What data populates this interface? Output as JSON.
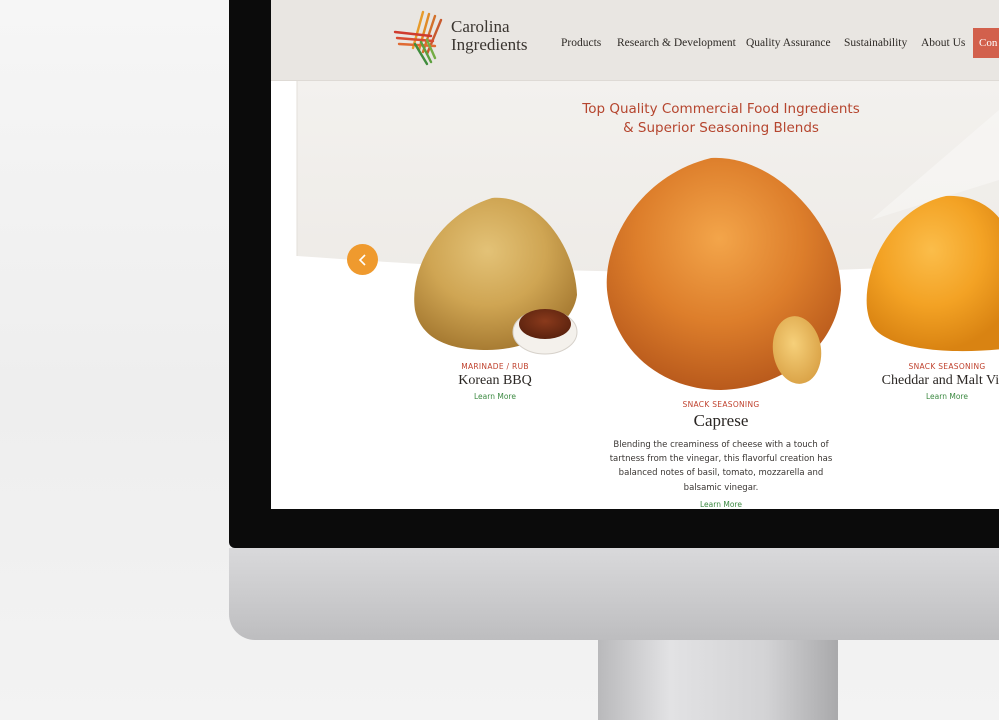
{
  "brand": {
    "line1": "Carolina",
    "line2": "Ingredients"
  },
  "nav": {
    "items": [
      "Products",
      "Research & Development",
      "Quality Assurance",
      "Sustainability",
      "About Us"
    ],
    "contact_label": "Con"
  },
  "hero": {
    "title_line1": "Top Quality Commercial Food Ingredients",
    "title_line2": "& Superior Seasoning Blends"
  },
  "icons": {
    "prev": "chevron-left-icon",
    "logo": "carolina-ingredients-logo"
  },
  "products": [
    {
      "category": "MARINADE / RUB",
      "name": "Korean BBQ",
      "link": "Learn More"
    },
    {
      "category": "SNACK SEASONING",
      "name": "Caprese",
      "description_lines": [
        "Blending the creaminess of cheese with a touch of",
        "tartness from the vinegar, this flavorful creation has",
        "balanced notes of basil, tomato, mozzarella and",
        "balsamic vinegar."
      ],
      "link": "Learn More"
    },
    {
      "category": "SNACK SEASONING",
      "name": "Cheddar and Malt Vine",
      "link": "Learn More"
    }
  ],
  "colors": {
    "accent_red": "#b5452e",
    "accent_orange": "#ef9a2e",
    "link_green": "#3c8a42",
    "contact_button": "#d2604c",
    "header_bg": "#e9e6e2"
  }
}
